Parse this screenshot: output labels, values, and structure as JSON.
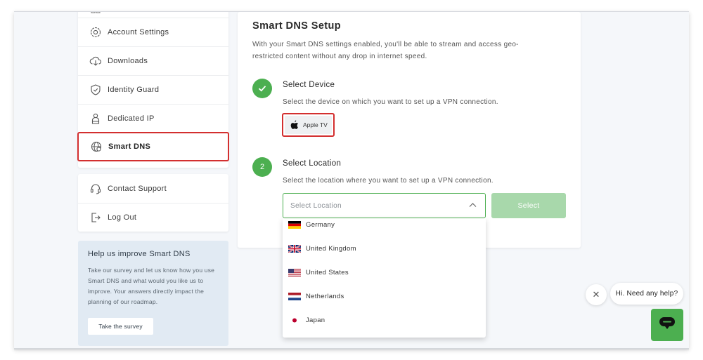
{
  "sidebar": {
    "items": [
      {
        "label": "Account Settings",
        "icon": "gear-icon"
      },
      {
        "label": "Downloads",
        "icon": "cloud-download-icon"
      },
      {
        "label": "Identity Guard",
        "icon": "shield-icon"
      },
      {
        "label": "Dedicated IP",
        "icon": "dedicated-ip-icon"
      },
      {
        "label": "Smart DNS",
        "icon": "globe-icon",
        "active": true
      }
    ],
    "support_items": [
      {
        "label": "Contact Support",
        "icon": "headset-icon"
      },
      {
        "label": "Log Out",
        "icon": "logout-icon"
      }
    ]
  },
  "help": {
    "title": "Help us improve Smart DNS",
    "text": "Take our survey and let us know how you use Smart DNS and what would you like us to improve. Your answers directly impact the planning of our roadmap.",
    "button": "Take the survey"
  },
  "main": {
    "title": "Smart DNS Setup",
    "intro": "With your Smart DNS settings enabled, you'll be able to stream and access geo-restricted content without any drop in internet speed.",
    "step1": {
      "title": "Select Device",
      "desc": "Select the device on which you want to set up a VPN connection.",
      "device": "Apple TV"
    },
    "step2": {
      "number": "2",
      "title": "Select Location",
      "desc": "Select the location where you want to set up a VPN connection.",
      "placeholder": "Select Location",
      "button": "Select"
    }
  },
  "dropdown": {
    "options": [
      "Germany",
      "United Kingdom",
      "United States",
      "Netherlands",
      "Japan"
    ]
  },
  "chat": {
    "greeting": "Hi. Need any help?",
    "close": "✕"
  },
  "colors": {
    "accent": "#4caf50",
    "highlight": "#d32f2f",
    "select_disabled": "#a8d8ab"
  }
}
